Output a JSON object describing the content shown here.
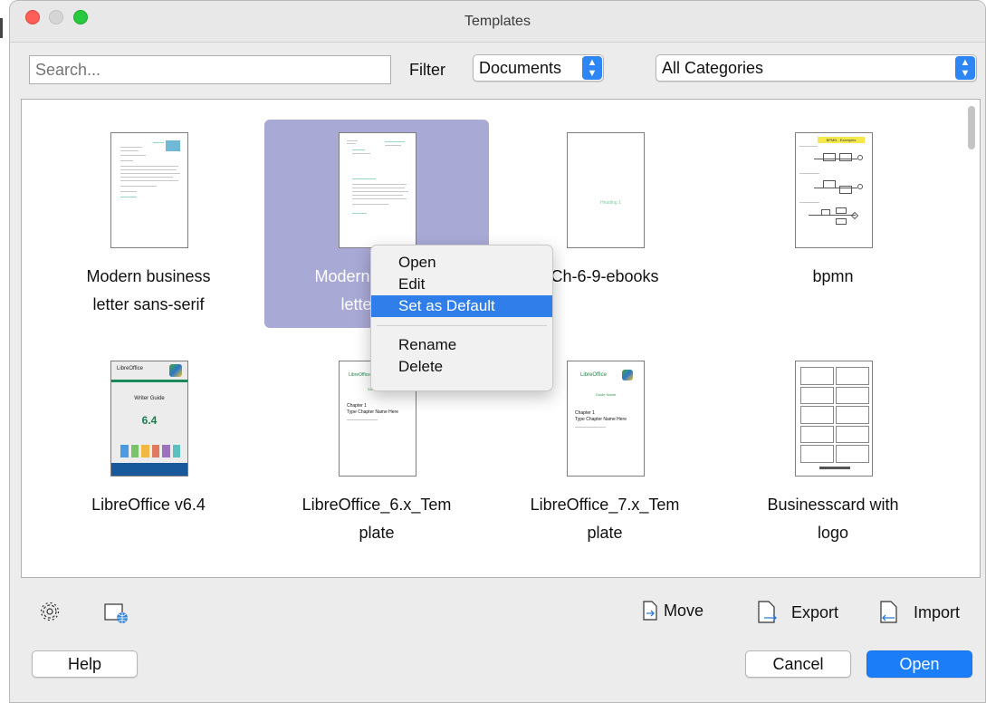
{
  "window": {
    "title": "Templates"
  },
  "toolbar": {
    "search_placeholder": "Search...",
    "filter_label": "Filter",
    "filter_value": "Documents",
    "category_value": "All Categories"
  },
  "templates": [
    {
      "line1": "Modern business",
      "line2": "letter sans-serif"
    },
    {
      "line1": "Modern business",
      "line2": "letter serif"
    },
    {
      "line1": "Ch-6-9-ebooks",
      "line2": ""
    },
    {
      "line1": "bpmn",
      "line2": ""
    },
    {
      "line1": "LibreOffice v6.4",
      "line2": ""
    },
    {
      "line1": "LibreOffice_6.x_Tem",
      "line2": "plate"
    },
    {
      "line1": "LibreOffice_7.x_Tem",
      "line2": "plate"
    },
    {
      "line1": "Businesscard with",
      "line2": "logo"
    }
  ],
  "thumb_text": {
    "writer_brand": "LibreOffice",
    "writer_guide": "Writer Guide",
    "writer_version": "6.4",
    "guide_title": "Guide Name",
    "chapter_label": "Chapter 1",
    "chapter_name": "Type Chapter Name Here",
    "heading_label": "Heading 1",
    "bpmn_title": "BPMN - Examples"
  },
  "context_menu": {
    "open": "Open",
    "edit": "Edit",
    "set_default": "Set as Default",
    "rename": "Rename",
    "delete": "Delete"
  },
  "bottom_actions": {
    "move": "Move",
    "export": "Export",
    "import": "Import"
  },
  "buttons": {
    "help": "Help",
    "cancel": "Cancel",
    "open": "Open"
  },
  "colors": {
    "accent": "#1b7df7",
    "selection": "#a9a9d6",
    "menu_highlight": "#2f7ee9"
  }
}
